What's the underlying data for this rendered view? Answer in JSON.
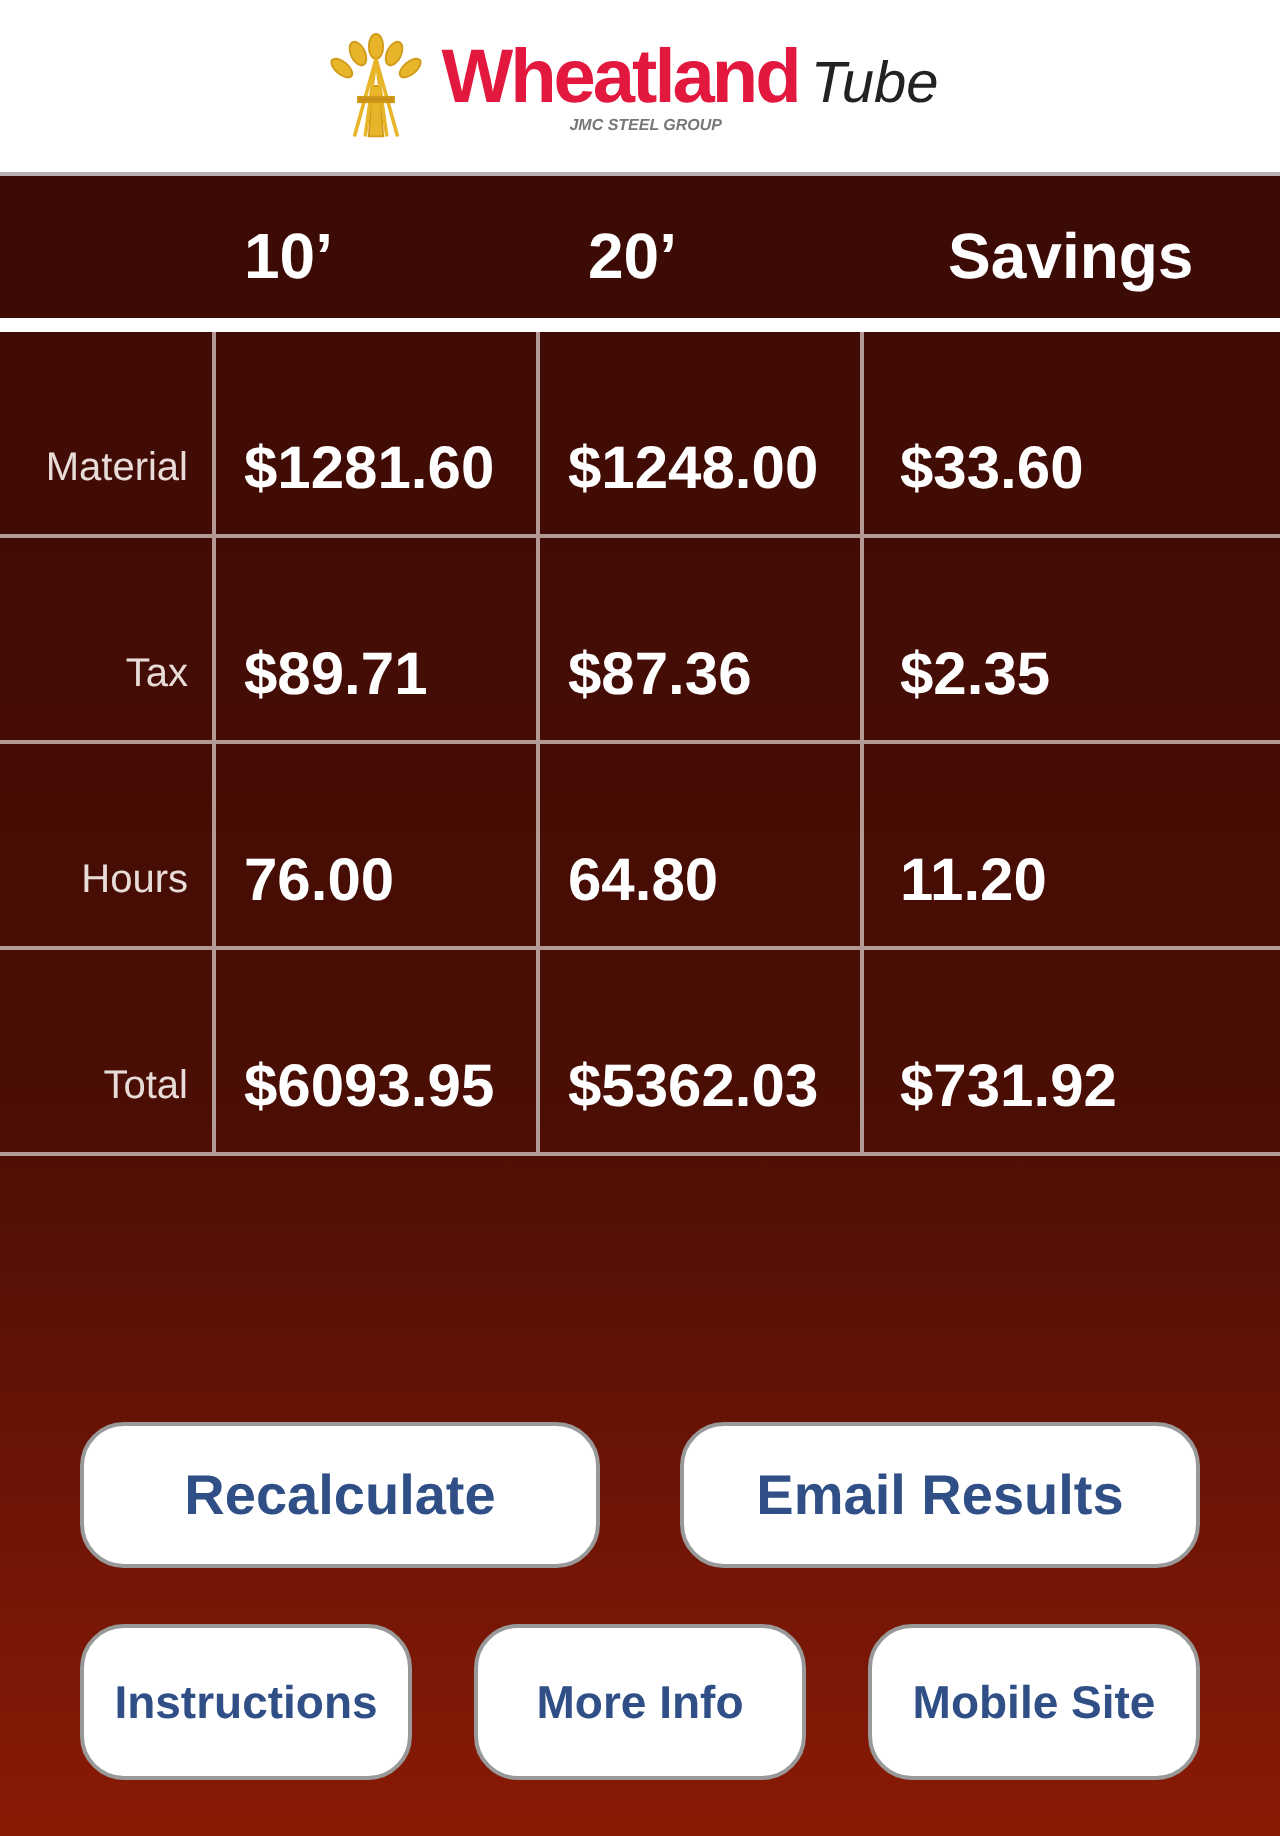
{
  "logo": {
    "name": "Wheatland",
    "suffix": "Tube",
    "tagline": "JMC STEEL GROUP"
  },
  "table": {
    "columns": [
      "10’",
      "20’",
      "Savings"
    ],
    "rows": [
      {
        "label": "Material",
        "values": [
          "$1281.60",
          "$1248.00",
          "$33.60"
        ]
      },
      {
        "label": "Tax",
        "values": [
          "$89.71",
          "$87.36",
          "$2.35"
        ]
      },
      {
        "label": "Hours",
        "values": [
          "76.00",
          "64.80",
          "11.20"
        ]
      },
      {
        "label": "Total",
        "values": [
          "$6093.95",
          "$5362.03",
          "$731.92"
        ]
      }
    ]
  },
  "buttons": [
    [
      "Recalculate",
      "Email Results"
    ],
    [
      "Instructions",
      "More Info",
      "Mobile Site"
    ]
  ]
}
